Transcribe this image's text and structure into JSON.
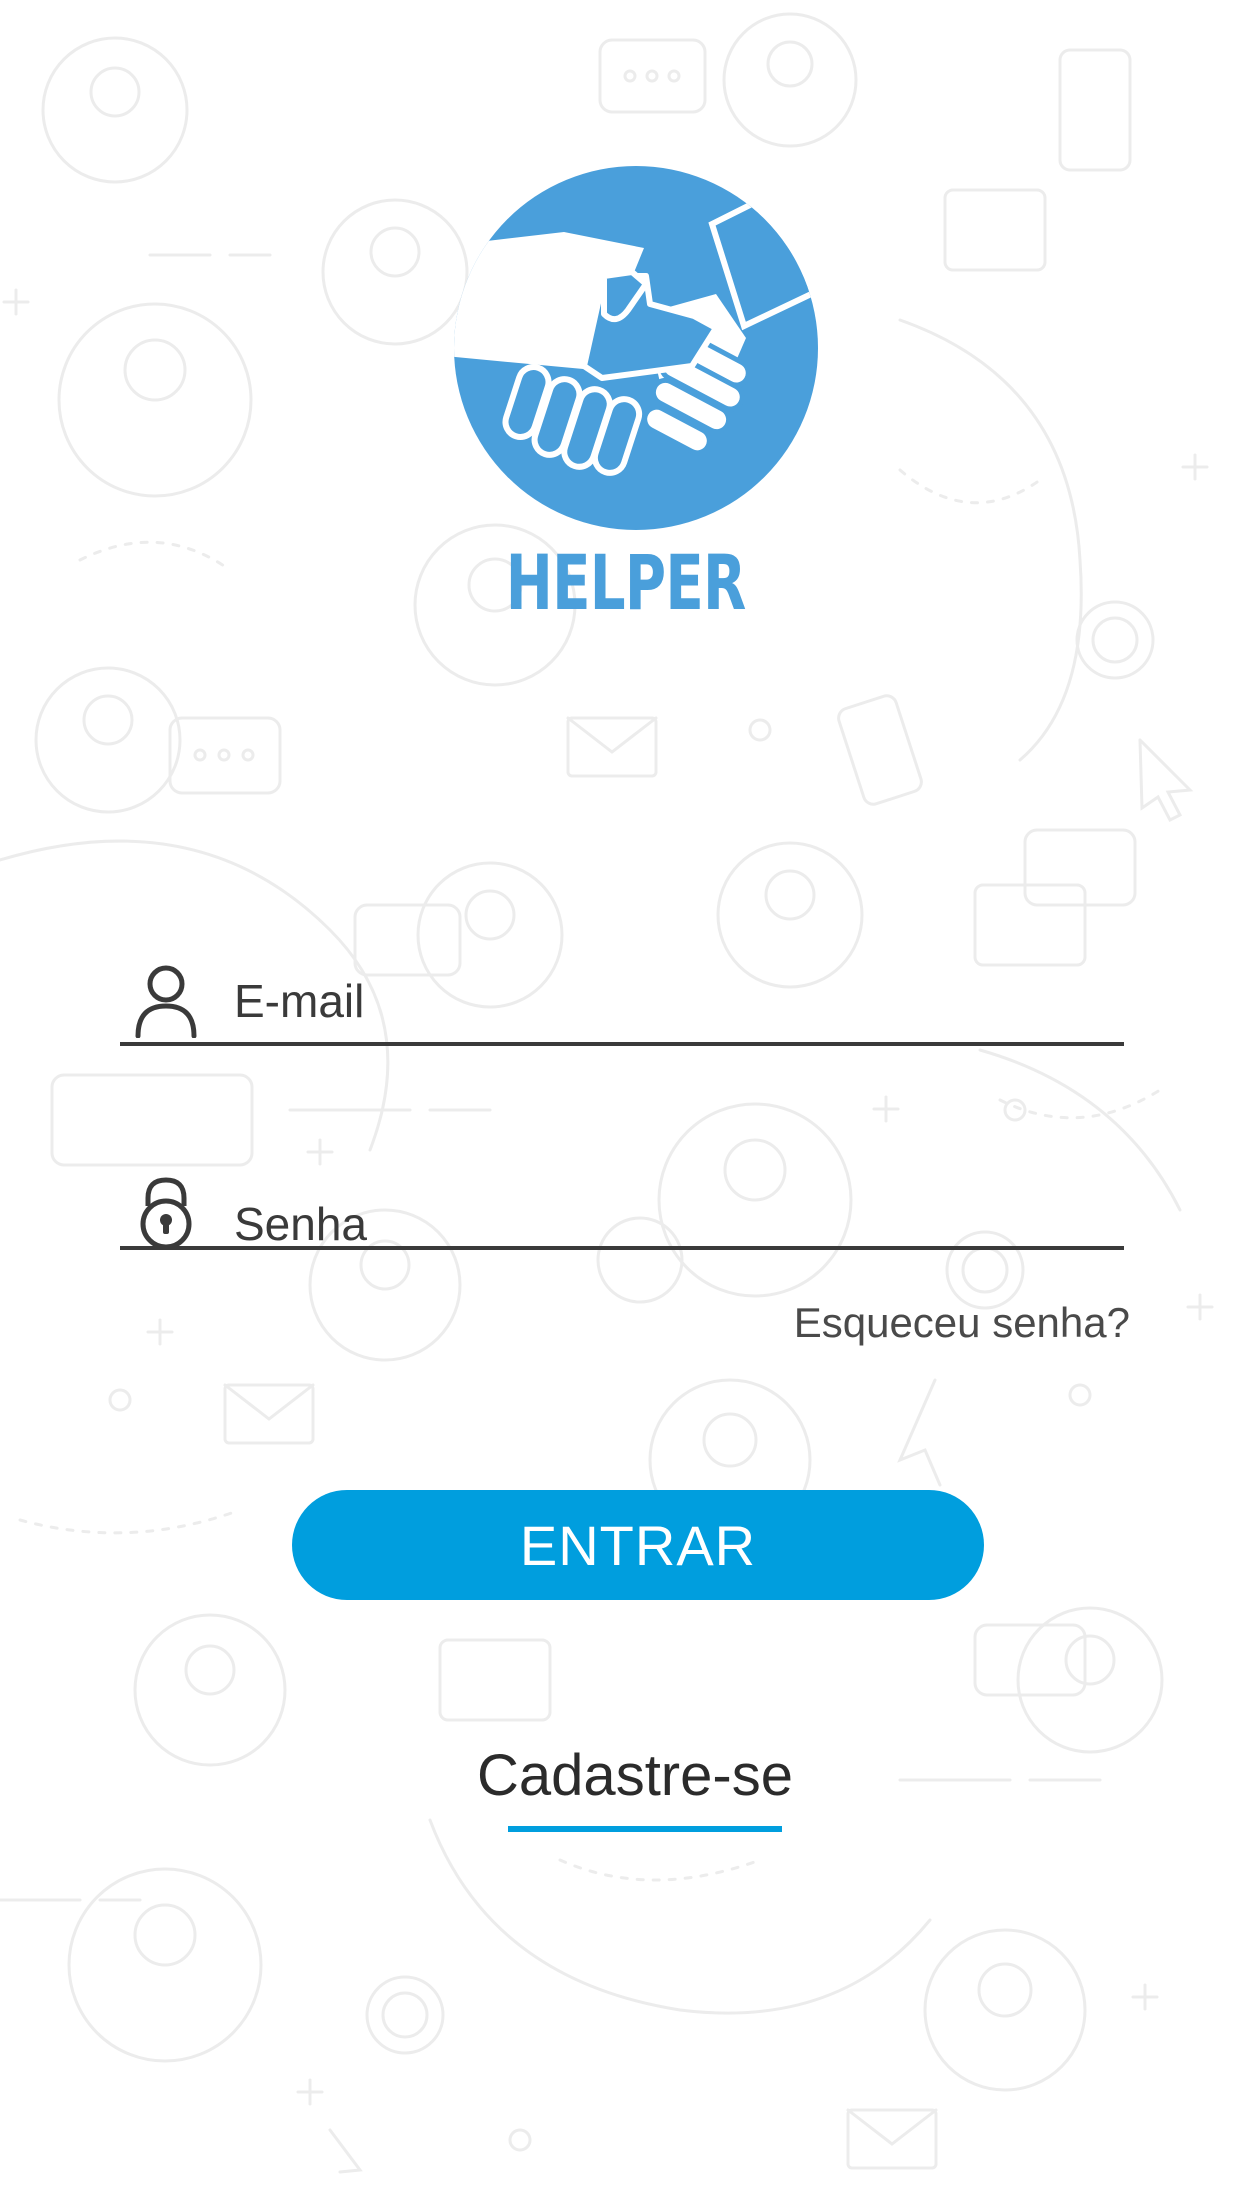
{
  "app": {
    "brand_name": "HELPER"
  },
  "login_form": {
    "email_placeholder": "E-mail",
    "password_placeholder": "Senha",
    "forgot_password_label": "Esqueceu senha?",
    "submit_label": "ENTRAR",
    "signup_label": "Cadastre-se"
  },
  "icons": {
    "email_field": "user-icon",
    "password_field": "lock-icon",
    "logo": "handshake-icon"
  },
  "colors": {
    "primary": "#009ede",
    "logo_blue": "#4a9fdb",
    "text_dark": "#3a3a3a",
    "background": "#ffffff",
    "pattern": "#ececec"
  }
}
